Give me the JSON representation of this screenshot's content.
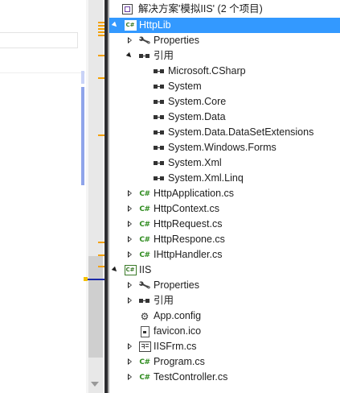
{
  "solution_explorer": {
    "rows": [
      {
        "label": "解决方案'模拟IIS' (2 个项目)",
        "icon": "solution-icon",
        "expander": "none"
      },
      {
        "label": "HttpLib",
        "icon": "csharp-project-icon",
        "expander": "open",
        "selected": true
      },
      {
        "label": "Properties",
        "icon": "wrench-icon",
        "expander": "closed"
      },
      {
        "label": "引用",
        "icon": "references-icon",
        "expander": "open"
      },
      {
        "label": "Microsoft.CSharp",
        "icon": "reference-icon",
        "expander": "none"
      },
      {
        "label": "System",
        "icon": "reference-icon",
        "expander": "none"
      },
      {
        "label": "System.Core",
        "icon": "reference-icon",
        "expander": "none"
      },
      {
        "label": "System.Data",
        "icon": "reference-icon",
        "expander": "none"
      },
      {
        "label": "System.Data.DataSetExtensions",
        "icon": "reference-icon",
        "expander": "none"
      },
      {
        "label": "System.Windows.Forms",
        "icon": "reference-icon",
        "expander": "none"
      },
      {
        "label": "System.Xml",
        "icon": "reference-icon",
        "expander": "none"
      },
      {
        "label": "System.Xml.Linq",
        "icon": "reference-icon",
        "expander": "none"
      },
      {
        "label": "HttpApplication.cs",
        "icon": "csharp-file-icon",
        "expander": "closed"
      },
      {
        "label": "HttpContext.cs",
        "icon": "csharp-file-icon",
        "expander": "closed"
      },
      {
        "label": "HttpRequest.cs",
        "icon": "csharp-file-icon",
        "expander": "closed"
      },
      {
        "label": "HttpRespone.cs",
        "icon": "csharp-file-icon",
        "expander": "closed"
      },
      {
        "label": "IHttpHandler.cs",
        "icon": "csharp-file-icon",
        "expander": "closed"
      },
      {
        "label": "IIS",
        "icon": "csharp-project-icon",
        "expander": "open"
      },
      {
        "label": "Properties",
        "icon": "wrench-icon",
        "expander": "closed"
      },
      {
        "label": "引用",
        "icon": "references-icon",
        "expander": "closed"
      },
      {
        "label": "App.config",
        "icon": "config-icon",
        "expander": "none"
      },
      {
        "label": "favicon.ico",
        "icon": "icon-file-icon",
        "expander": "none"
      },
      {
        "label": "IISFrm.cs",
        "icon": "form-icon",
        "expander": "closed"
      },
      {
        "label": "Program.cs",
        "icon": "csharp-file-icon",
        "expander": "closed"
      },
      {
        "label": "TestController.cs",
        "icon": "csharp-file-icon",
        "expander": "closed"
      }
    ],
    "csharp_glyph": "C#",
    "selection_color": "#3399ff"
  }
}
